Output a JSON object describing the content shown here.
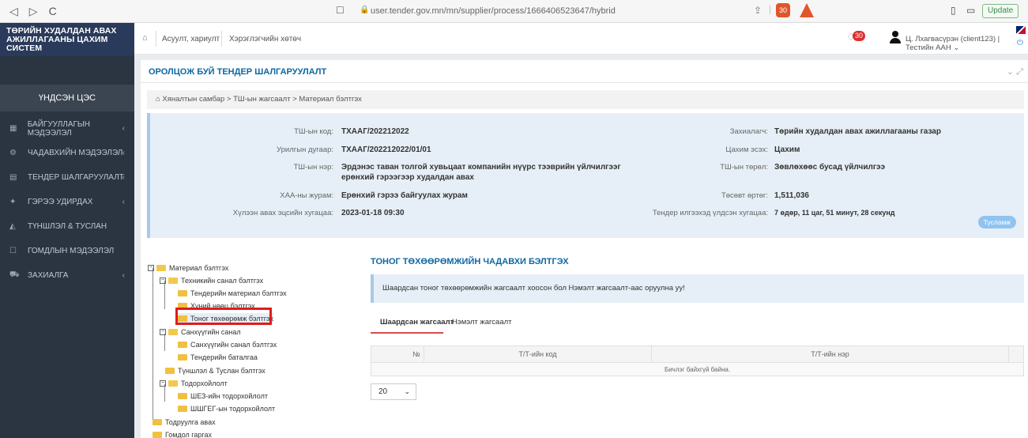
{
  "browser": {
    "url": "user.tender.gov.mn/mn/supplier/process/1666406523647/hybrid",
    "ext_badge": "30",
    "update_label": "Update"
  },
  "sidebar": {
    "brand_line1": "ТӨРИЙН ХУДАЛДАН АВАХ",
    "brand_line2": "АЖИЛЛАГААНЫ ЦАХИМ СИСТЕМ",
    "home": "ҮНДСЭН ЦЭС",
    "items": [
      {
        "label": "БАЙГУУЛЛАГЫН МЭДЭЭЛЭЛ",
        "icon": "building-icon",
        "arrow": true
      },
      {
        "label": "ЧАДАВХИЙН МЭДЭЭЛЭЛ",
        "icon": "gears-icon",
        "arrow": true
      },
      {
        "label": "ТЕНДЕР ШАЛГАРУУЛАЛТ",
        "icon": "list-icon",
        "arrow": true
      },
      {
        "label": "ГЭРЭЭ УДИРДАХ",
        "icon": "handshake-icon",
        "arrow": true
      },
      {
        "label": "ТҮНШЛЭЛ & ТУСЛАН",
        "icon": "partners-icon",
        "arrow": false
      },
      {
        "label": "ГОМДЛЫН МЭДЭЭЛЭЛ",
        "icon": "comment-icon",
        "arrow": false
      },
      {
        "label": "ЗАХИАЛГА",
        "icon": "cart-icon",
        "arrow": true
      }
    ]
  },
  "header": {
    "qa": "Асуулт, хариулт",
    "guide": "Хэрэглэгчийн хөтөч",
    "notif_count": "30",
    "user": "Ц. Лхагвасүрэн (client123) | Тестийн ААН"
  },
  "page": {
    "title": "ОРОЛЦОЖ БУЙ ТЕНДЕР ШАЛГАРУУЛАЛТ",
    "breadcrumb": "Хяналтын самбар  >  ТШ-ын жагсаалт  >  Материал бэлтгэх"
  },
  "info": {
    "code_label": "ТШ-ын код:",
    "code": "ТХААГ/202212022",
    "invite_label": "Урилгын дугаар:",
    "invite": "ТХААГ/202212022/01/01",
    "name_label": "ТШ-ын нэр:",
    "name_line1": "Эрдэнэс таван толгой хувьцаат компанийн нүүрс тээврийн үйлчилгээг",
    "name_line2": "ерөнхий гэрээгээр худалдан авах",
    "procedure_label": "ХАА-ны журам:",
    "procedure": "Ерөнхий гэрээ байгуулах журам",
    "deadline_label": "Хүлээн авах эцсийн хугацаа:",
    "deadline": "2023-01-18 09:30",
    "buyer_label": "Захиалагч:",
    "buyer": "Төрийн худалдан авах ажиллагааны газар",
    "mode_label": "Цахим эсэх:",
    "mode": "Цахим",
    "type_label": "ТШ-ын төрөл:",
    "type": "Зөвлөхөөс бусад үйлчилгээ",
    "budget_label": "Төсөвт өртөг:",
    "budget": "1,511,036",
    "remaining_label": "Тендер илгээхэд үлдсэн хугацаа:",
    "remaining": "7 өдөр, 11 цаг, 51 минут, 28 секунд",
    "help": "Тусламж"
  },
  "tree": [
    {
      "label": "Материал бэлтгэх",
      "level": 0,
      "open": true,
      "box": "−"
    },
    {
      "label": "Техникийн санал бэлтгэх",
      "level": 1,
      "open": true,
      "box": "−"
    },
    {
      "label": "Тендерийн материал бэлтгэх",
      "level": 2
    },
    {
      "label": "Хүний нөөц бэлтгэх",
      "level": 2
    },
    {
      "label": "Тоног төхөөрөмж бэлтгэх",
      "level": 2
    },
    {
      "label": "Санхүүгийн санал",
      "level": 1,
      "open": true,
      "box": "−"
    },
    {
      "label": "Санхүүгийн санал бэлтгэх",
      "level": 2
    },
    {
      "label": "Тендерийн баталгаа",
      "level": 2
    },
    {
      "label": "Түншлэл & Туслан бэлтгэх",
      "level": 1
    },
    {
      "label": "Тодорхойлолт",
      "level": 1,
      "open": true,
      "box": "−"
    },
    {
      "label": "ШЕЗ-ийн тодорхойлолт",
      "level": 2
    },
    {
      "label": "ШШГЕГ-ын тодорхойлолт",
      "level": 2
    },
    {
      "label": "Тодруулга авах",
      "level": 0
    },
    {
      "label": "Гомдол гаргах",
      "level": 0
    }
  ],
  "content": {
    "title": "ТОНОГ ТӨХӨӨРӨМЖИЙН ЧАДАВХИ БЭЛТГЭХ",
    "note": "Шаардсан тоног төхөөрөмжийн жагсаалт хоосон бол Нэмэлт жагсаалт-аас оруулна уу!",
    "tab_required": "Шаардсан жагсаалт",
    "tab_extra": "Нэмэлт жагсаалт",
    "col_no": "№",
    "col_code": "Т/Т-ийн код",
    "col_name": "Т/Т-ийн нэр",
    "empty": "Бичлэг байхгүй байна.",
    "page_size": "20"
  }
}
